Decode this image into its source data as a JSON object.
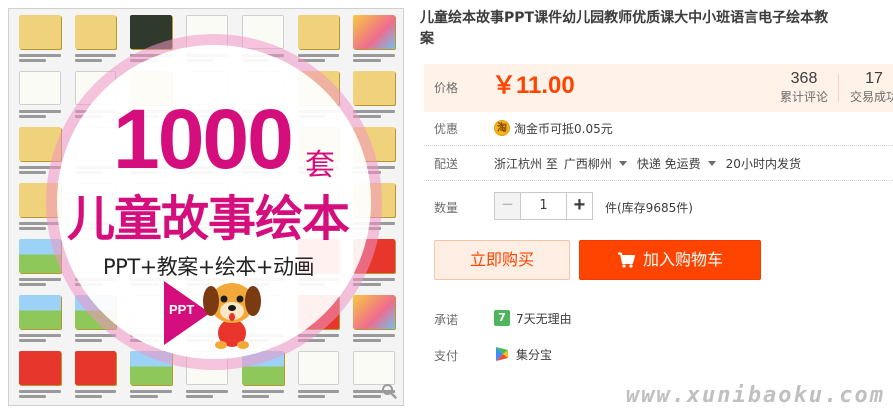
{
  "product_image": {
    "big_number": "1000",
    "unit_char": "套",
    "title": "儿童故事绘本",
    "subtitle": "PPT+教案+绘本+动画",
    "ppt_badge": "PPT",
    "zoom_icon": "magnifier-icon"
  },
  "product": {
    "title_line1": "儿童绘本故事PPT课件幼儿园教师优质课大中小班语言电子绘本教",
    "title_line2": "案"
  },
  "price": {
    "label": "价格",
    "value": "￥11.00",
    "reviews_count": "368",
    "reviews_label": "累计评论",
    "sales_count": "17",
    "sales_label": "交易成功"
  },
  "promo": {
    "label": "优惠",
    "icon_char": "淘",
    "text": "淘金币可抵0.05元"
  },
  "shipping": {
    "label": "配送",
    "from": "浙江杭州 至",
    "to": "广西柳州",
    "method": "快递 免运费",
    "dispatch": "20小时内发货"
  },
  "quantity": {
    "label": "数量",
    "minus": "−",
    "value": "1",
    "plus": "+",
    "stock": "件(库存9685件)"
  },
  "actions": {
    "buy_now": "立即购买",
    "add_to_cart": "加入购物车"
  },
  "promise": {
    "label": "承诺",
    "icon_char": "7",
    "text": "7天无理由"
  },
  "payment": {
    "label": "支付",
    "text": "集分宝"
  },
  "watermark": "www.xunibaoku.com",
  "colors": {
    "accent": "#ff4400",
    "price_bg": "#fff2e8",
    "poster_pink": "#d40f7d"
  }
}
